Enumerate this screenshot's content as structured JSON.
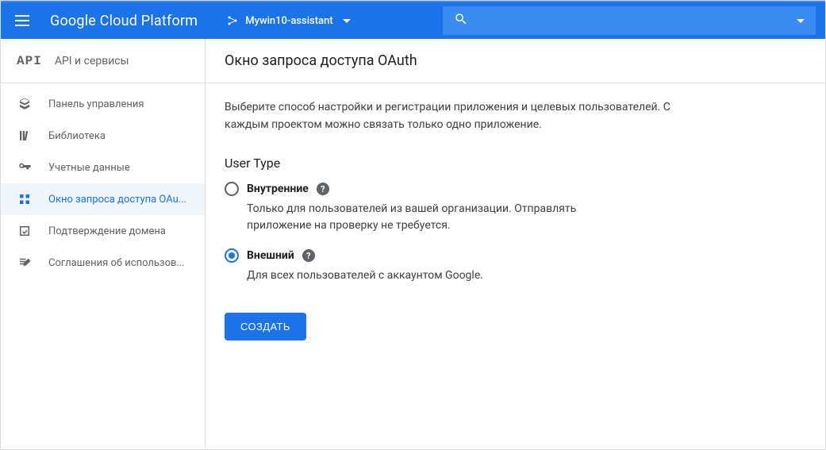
{
  "header": {
    "platform_name": "Google Cloud Platform",
    "project_name": "Mywin10-assistant",
    "search_placeholder": ""
  },
  "sidebar": {
    "badge": "API",
    "title": "API и сервисы",
    "items": [
      {
        "label": "Панель управления",
        "active": false
      },
      {
        "label": "Библиотека",
        "active": false
      },
      {
        "label": "Учетные данные",
        "active": false
      },
      {
        "label": "Окно запроса доступа OAu...",
        "active": true
      },
      {
        "label": "Подтверждение домена",
        "active": false
      },
      {
        "label": "Соглашения об использов...",
        "active": false
      }
    ]
  },
  "main": {
    "title": "Окно запроса доступа OAuth",
    "intro": "Выберите способ настройки и регистрации приложения и целевых пользователей. С каждым проектом можно связать только одно приложение.",
    "section_title": "User Type",
    "options": [
      {
        "label": "Внутренние",
        "desc": "Только для пользователей из вашей организации. Отправлять приложение на проверку не требуется.",
        "checked": false
      },
      {
        "label": "Внешний",
        "desc": "Для всех пользователей с аккаунтом Google.",
        "checked": true
      }
    ],
    "create_label": "СОЗДАТЬ"
  }
}
